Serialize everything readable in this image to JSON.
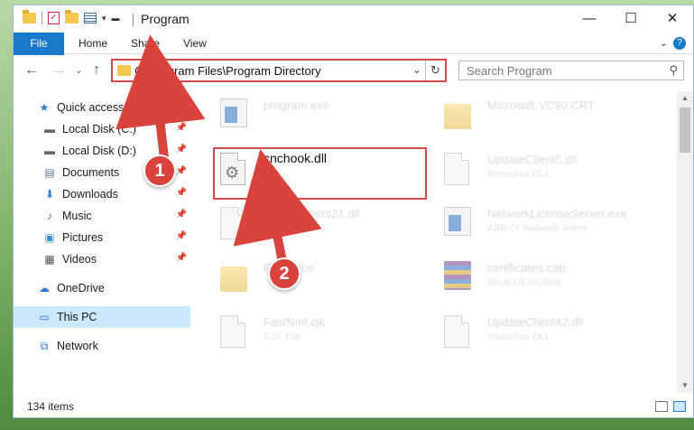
{
  "window": {
    "title": "Program"
  },
  "ribbon": {
    "tabs": [
      "File",
      "Home",
      "Share",
      "View"
    ]
  },
  "address": {
    "path": "C:\\Program Files\\Program Directory"
  },
  "search": {
    "placeholder": "Search Program"
  },
  "sidebar": {
    "items": [
      {
        "label": "Quick access",
        "icon": "star-icon",
        "pinned": false
      },
      {
        "label": "Local Disk (C:)",
        "icon": "drive-icon",
        "pinned": true
      },
      {
        "label": "Local Disk (D:)",
        "icon": "drive-icon",
        "pinned": true
      },
      {
        "label": "Documents",
        "icon": "documents-icon",
        "pinned": true
      },
      {
        "label": "Downloads",
        "icon": "downloads-icon",
        "pinned": true
      },
      {
        "label": "Music",
        "icon": "music-icon",
        "pinned": true
      },
      {
        "label": "Pictures",
        "icon": "pictures-icon",
        "pinned": true
      },
      {
        "label": "Videos",
        "icon": "videos-icon",
        "pinned": true
      },
      {
        "label": "OneDrive",
        "icon": "cloud-icon",
        "pinned": false
      },
      {
        "label": "This PC",
        "icon": "computer-icon",
        "pinned": false,
        "selected": true
      },
      {
        "label": "Network",
        "icon": "network-icon",
        "pinned": false
      }
    ]
  },
  "files": [
    {
      "name": "program.exe",
      "type": "",
      "icon": "exe-icon"
    },
    {
      "name": "Microsoft.VC90.CRT",
      "type": "",
      "icon": "folder-icon"
    },
    {
      "name": "cnchook.dll",
      "type": "",
      "icon": "dll-icon",
      "highlighted": true
    },
    {
      "name": "UpdateClient5.dll",
      "type": "Resource DLL",
      "icon": "dll-icon"
    },
    {
      "name": "UpdateClient21.dll",
      "type": "Resource DLL",
      "icon": "dll-icon"
    },
    {
      "name": "NetworkLicenseServer.exe",
      "type": "ABBYY Network licens...",
      "icon": "exe-icon"
    },
    {
      "name": "Resource",
      "type": "",
      "icon": "folder-icon"
    },
    {
      "name": "certificates.cab",
      "type": "WinRAR Archive",
      "icon": "winrar-icon"
    },
    {
      "name": "FastNml.cjk",
      "type": "CJK File",
      "icon": "doc-icon"
    },
    {
      "name": "UpdateClient42.dll",
      "type": "Resource DLL",
      "icon": "dll-icon"
    }
  ],
  "status": {
    "item_count": "134 items"
  },
  "annotations": {
    "step1": "1",
    "step2": "2"
  },
  "colors": {
    "annotation_red": "#d9433d",
    "file_tab_blue": "#1979ca",
    "selected_bg": "#cce8ff"
  }
}
